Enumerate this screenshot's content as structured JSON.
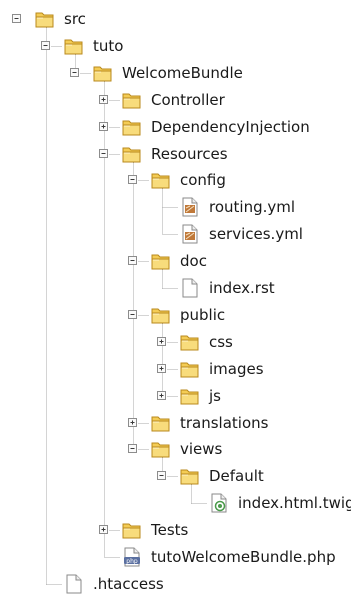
{
  "tree": [
    {
      "label": "src",
      "kind": "folder",
      "depth": 0,
      "state": "expanded",
      "last": true
    },
    {
      "label": "tuto",
      "kind": "folder",
      "depth": 1,
      "state": "expanded",
      "last": false
    },
    {
      "label": "WelcomeBundle",
      "kind": "folder",
      "depth": 2,
      "state": "expanded",
      "last": true
    },
    {
      "label": "Controller",
      "kind": "folder",
      "depth": 3,
      "state": "collapsed",
      "last": false
    },
    {
      "label": "DependencyInjection",
      "kind": "folder",
      "depth": 3,
      "state": "collapsed",
      "last": false
    },
    {
      "label": "Resources",
      "kind": "folder",
      "depth": 3,
      "state": "expanded",
      "last": false
    },
    {
      "label": "config",
      "kind": "folder",
      "depth": 4,
      "state": "expanded",
      "last": false
    },
    {
      "label": "routing.yml",
      "kind": "yml",
      "depth": 5,
      "state": "leaf",
      "last": false
    },
    {
      "label": "services.yml",
      "kind": "yml",
      "depth": 5,
      "state": "leaf",
      "last": true
    },
    {
      "label": "doc",
      "kind": "folder",
      "depth": 4,
      "state": "expanded",
      "last": false
    },
    {
      "label": "index.rst",
      "kind": "file",
      "depth": 5,
      "state": "leaf",
      "last": true
    },
    {
      "label": "public",
      "kind": "folder",
      "depth": 4,
      "state": "expanded",
      "last": false
    },
    {
      "label": "css",
      "kind": "folder",
      "depth": 5,
      "state": "collapsed",
      "last": false
    },
    {
      "label": "images",
      "kind": "folder",
      "depth": 5,
      "state": "collapsed",
      "last": false
    },
    {
      "label": "js",
      "kind": "folder",
      "depth": 5,
      "state": "collapsed",
      "last": true
    },
    {
      "label": "translations",
      "kind": "folder",
      "depth": 4,
      "state": "collapsed",
      "last": false
    },
    {
      "label": "views",
      "kind": "folder",
      "depth": 4,
      "state": "expanded",
      "last": true
    },
    {
      "label": "Default",
      "kind": "folder",
      "depth": 5,
      "state": "expanded",
      "last": true
    },
    {
      "label": "index.html.twig",
      "kind": "twig",
      "depth": 6,
      "state": "leaf",
      "last": true
    },
    {
      "label": "Tests",
      "kind": "folder",
      "depth": 3,
      "state": "collapsed",
      "last": false
    },
    {
      "label": "tutoWelcomeBundle.php",
      "kind": "php",
      "depth": 3,
      "state": "leaf",
      "last": true
    },
    {
      "label": ".htaccess",
      "kind": "file",
      "depth": 1,
      "state": "leaf",
      "last": true
    }
  ],
  "icon_names": {
    "folder": "folder-icon",
    "yml": "yml-file-icon",
    "file": "file-icon",
    "twig": "twig-file-icon",
    "php": "php-file-icon"
  },
  "colors": {
    "folder_body": "#f4cc55",
    "folder_edge": "#b9891c",
    "folder_front": "#f8dc7c",
    "yml_badge": "#c0793a",
    "twig_badge": "#4a9a4a",
    "php_badge": "#5a6fa0",
    "guide_line": "#a8a8a8",
    "text": "#1a1a1a"
  }
}
